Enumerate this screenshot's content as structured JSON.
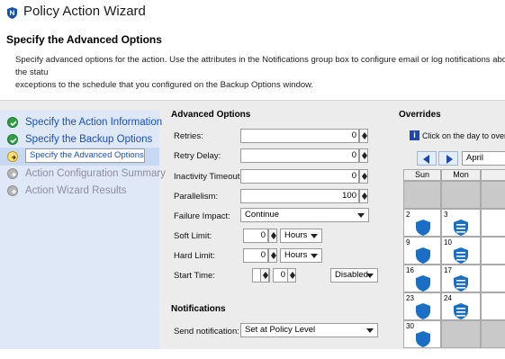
{
  "window": {
    "title": "Policy Action Wizard",
    "logo": "policy-shield-icon"
  },
  "header": {
    "title": "Specify the Advanced Options",
    "description": "Specify advanced options for the action. Use the attributes in the Notifications group box to configure email or log notifications about the statu\nexceptions to the schedule that you configured on the Backup Options window."
  },
  "steps": [
    {
      "label": "Specify the Action Information",
      "state": "done"
    },
    {
      "label": "Specify the Backup Options",
      "state": "done"
    },
    {
      "label": "Specify the Advanced Options",
      "state": "current"
    },
    {
      "label": "Action Configuration Summary",
      "state": "pending"
    },
    {
      "label": "Action Wizard Results",
      "state": "pending"
    }
  ],
  "advanced": {
    "legend": "Advanced Options",
    "retries": {
      "label": "Retries:",
      "value": "0"
    },
    "retry_delay": {
      "label": "Retry Delay:",
      "value": "0"
    },
    "inactivity": {
      "label": "Inactivity Timeout:",
      "value": "0"
    },
    "parallelism": {
      "label": "Parallelism:",
      "value": "100"
    },
    "failure_impact": {
      "label": "Failure Impact:",
      "value": "Continue"
    },
    "soft_limit": {
      "label": "Soft Limit:",
      "value": "0",
      "unit": "Hours"
    },
    "hard_limit": {
      "label": "Hard Limit:",
      "value": "0",
      "unit": "Hours"
    },
    "start_time": {
      "label": "Start Time:",
      "hour": "0",
      "minute": "0",
      "mode": "Disabled"
    }
  },
  "notifications": {
    "legend": "Notifications",
    "send": {
      "label": "Send notification:",
      "value": "Set at Policy Level"
    }
  },
  "overrides": {
    "legend": "Overrides",
    "hint": "Click on the day to overr",
    "month": "April",
    "day_headers": [
      "Sun",
      "Mon"
    ],
    "rows": [
      {
        "sun": "",
        "mon": "",
        "gray": true
      },
      {
        "sun": "2",
        "mon": "3"
      },
      {
        "sun": "9",
        "mon": "10"
      },
      {
        "sun": "16",
        "mon": "17"
      },
      {
        "sun": "23",
        "mon": "24"
      },
      {
        "sun": "30",
        "mon": ""
      }
    ],
    "colors": {
      "shield": "#1a6fc4",
      "shield_lines": "#ffffff"
    }
  }
}
